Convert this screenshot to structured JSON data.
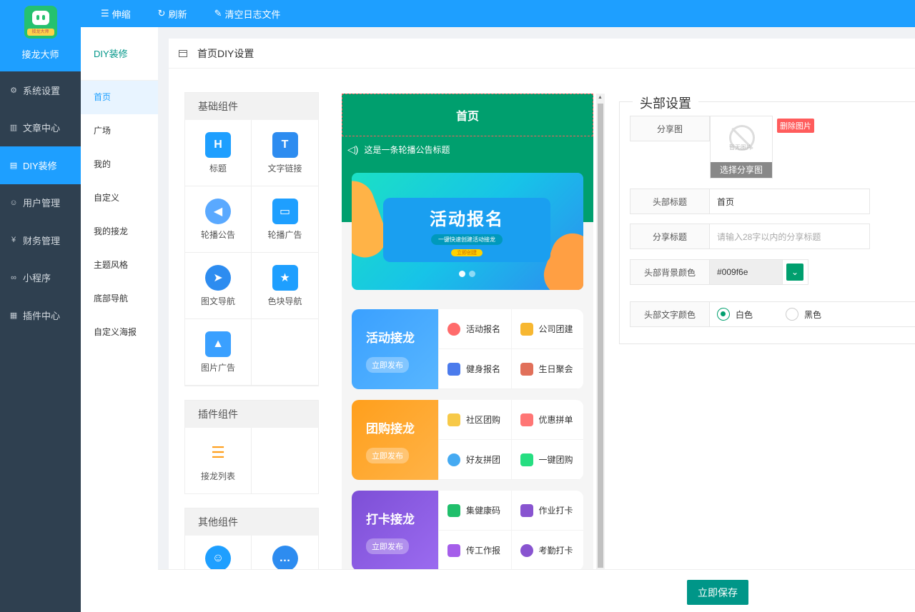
{
  "app": {
    "name": "接龙大师",
    "logo_tag": "接龙大师"
  },
  "sidebar": {
    "items": [
      {
        "label": "系统设置",
        "icon": "gear-icon"
      },
      {
        "label": "文章中心",
        "icon": "book-icon"
      },
      {
        "label": "DIY装修",
        "icon": "layout-icon"
      },
      {
        "label": "用户管理",
        "icon": "user-icon"
      },
      {
        "label": "财务管理",
        "icon": "yen-icon"
      },
      {
        "label": "小程序",
        "icon": "link-icon"
      },
      {
        "label": "插件中心",
        "icon": "grid-icon"
      }
    ]
  },
  "toolbar": {
    "collapse": "伸缩",
    "refresh": "刷新",
    "clear_log": "清空日志文件"
  },
  "subnav": {
    "title": "DIY装修",
    "items": [
      "首页",
      "广场",
      "我的",
      "自定义",
      "我的接龙",
      "主题风格",
      "底部导航",
      "自定义海报"
    ]
  },
  "page": {
    "title": "首页DIY设置"
  },
  "library": {
    "basic": {
      "title": "基础组件",
      "items": [
        "标题",
        "文字链接",
        "轮播公告",
        "轮播广告",
        "图文导航",
        "色块导航",
        "图片广告"
      ]
    },
    "plugin": {
      "title": "插件组件",
      "items": [
        "接龙列表"
      ]
    },
    "other": {
      "title": "其他组件"
    }
  },
  "preview": {
    "header_title": "首页",
    "notice": "这是一条轮播公告标题",
    "banner": {
      "title": "活动报名",
      "subtitle": "一键快速创建活动接龙",
      "button": "立即创建"
    },
    "cards": [
      {
        "title": "活动接龙",
        "button": "立即发布",
        "items": [
          "活动报名",
          "公司团建",
          "健身报名",
          "生日聚会"
        ]
      },
      {
        "title": "团购接龙",
        "button": "立即发布",
        "items": [
          "社区团购",
          "优惠拼单",
          "好友拼团",
          "一键团购"
        ]
      },
      {
        "title": "打卡接龙",
        "button": "立即发布",
        "items": [
          "集健康码",
          "作业打卡",
          "传工作报",
          "考勤打卡"
        ]
      }
    ]
  },
  "settings": {
    "title": "头部设置",
    "share_image_label": "分享图",
    "noimg_text": "暂无图片",
    "select_image": "选择分享图",
    "delete_image": "删除图片",
    "header_title_label": "头部标题",
    "header_title_value": "首页",
    "share_title_label": "分享标题",
    "share_title_placeholder": "请输入28字以内的分享标题",
    "bg_color_label": "头部背景颜色",
    "bg_color_value": "#009f6e",
    "text_color_label": "头部文字颜色",
    "text_color_options": [
      "白色",
      "黑色"
    ],
    "text_color_selected": "白色"
  },
  "footer": {
    "save": "立即保存"
  },
  "colors": {
    "primary": "#1E9FFF",
    "sidebar": "#2f4050",
    "theme_green": "#009f6e",
    "save": "#009688",
    "danger": "#ff5c5c"
  }
}
